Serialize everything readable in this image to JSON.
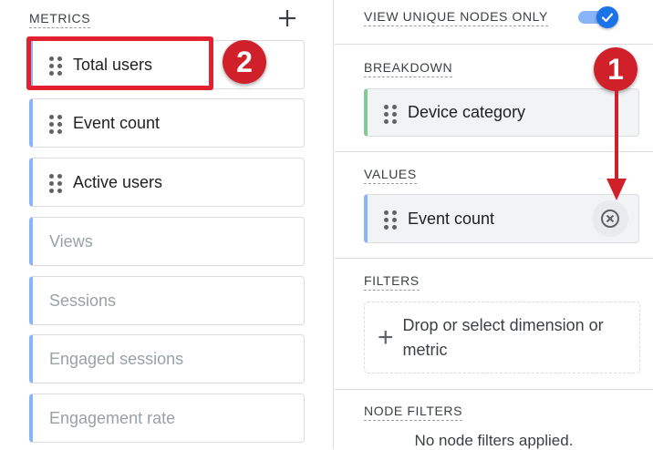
{
  "metrics": {
    "title": "METRICS",
    "add_icon": "plus-icon",
    "items": [
      {
        "label": "Total users",
        "active": true
      },
      {
        "label": "Event count",
        "active": true
      },
      {
        "label": "Active users",
        "active": true
      },
      {
        "label": "Views",
        "active": false
      },
      {
        "label": "Sessions",
        "active": false
      },
      {
        "label": "Engaged sessions",
        "active": false
      },
      {
        "label": "Engagement rate",
        "active": false
      }
    ]
  },
  "settings": {
    "unique_nodes_label": "VIEW UNIQUE NODES ONLY",
    "unique_nodes_on": true,
    "breakdown": {
      "title": "BREAKDOWN",
      "item": "Device category"
    },
    "values": {
      "title": "VALUES",
      "item": "Event count",
      "remove_icon": "remove-circle-icon"
    },
    "filters": {
      "title": "FILTERS",
      "drop_text": "Drop or select dimension or metric"
    },
    "node_filters": {
      "title": "NODE FILTERS",
      "empty_text": "No node filters applied."
    }
  },
  "annotations": {
    "step_one": "1",
    "step_two": "2",
    "accent_color": "#d0212b"
  },
  "colors": {
    "metric_accent": "#8ab4f8",
    "dimension_accent": "#81c995",
    "toggle_on": "#1a73e8"
  }
}
